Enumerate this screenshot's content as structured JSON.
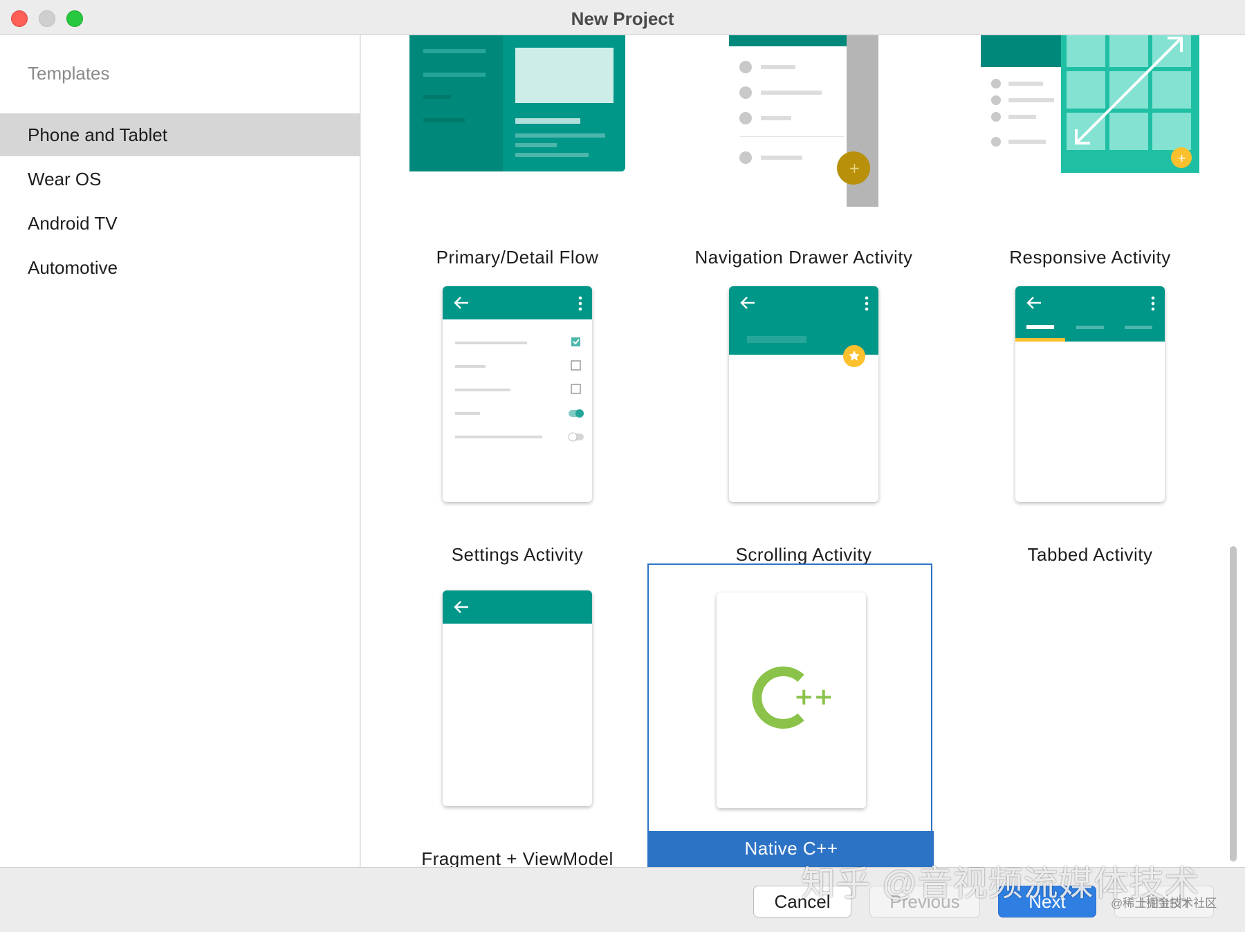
{
  "window": {
    "title": "New Project"
  },
  "sidebar": {
    "header": "Templates",
    "items": [
      {
        "label": "Phone and Tablet",
        "selected": true
      },
      {
        "label": "Wear OS",
        "selected": false
      },
      {
        "label": "Android TV",
        "selected": false
      },
      {
        "label": "Automotive",
        "selected": false
      }
    ]
  },
  "gallery": {
    "templates": [
      {
        "label": "Primary/Detail Flow",
        "selected": false
      },
      {
        "label": "Navigation Drawer Activity",
        "selected": false
      },
      {
        "label": "Responsive Activity",
        "selected": false
      },
      {
        "label": "Settings Activity",
        "selected": false
      },
      {
        "label": "Scrolling Activity",
        "selected": false
      },
      {
        "label": "Tabbed Activity",
        "selected": false
      },
      {
        "label": "Fragment + ViewModel",
        "selected": false
      },
      {
        "label": "Native C++",
        "selected": true
      }
    ],
    "cpp_logo_text": "++"
  },
  "footer": {
    "cancel_label": "Cancel",
    "previous_label": "Previous",
    "next_label": "Next",
    "finish_label": "Finish"
  },
  "watermark": {
    "main": "知乎 @音视频流媒体技术",
    "small": "@稀土掘金技术社区"
  },
  "colors": {
    "accent_teal": "#009688",
    "selection_blue": "#2d73c5",
    "next_blue": "#2f7fe3",
    "fab_yellow": "#fbc02d",
    "cpp_green": "#8bc34a"
  },
  "icons": [
    "back-arrow-icon",
    "more-vert-icon",
    "checkbox-icon",
    "toggle-icon",
    "star-icon",
    "add-icon",
    "cpp-logo-icon",
    "expand-arrow-icon"
  ]
}
